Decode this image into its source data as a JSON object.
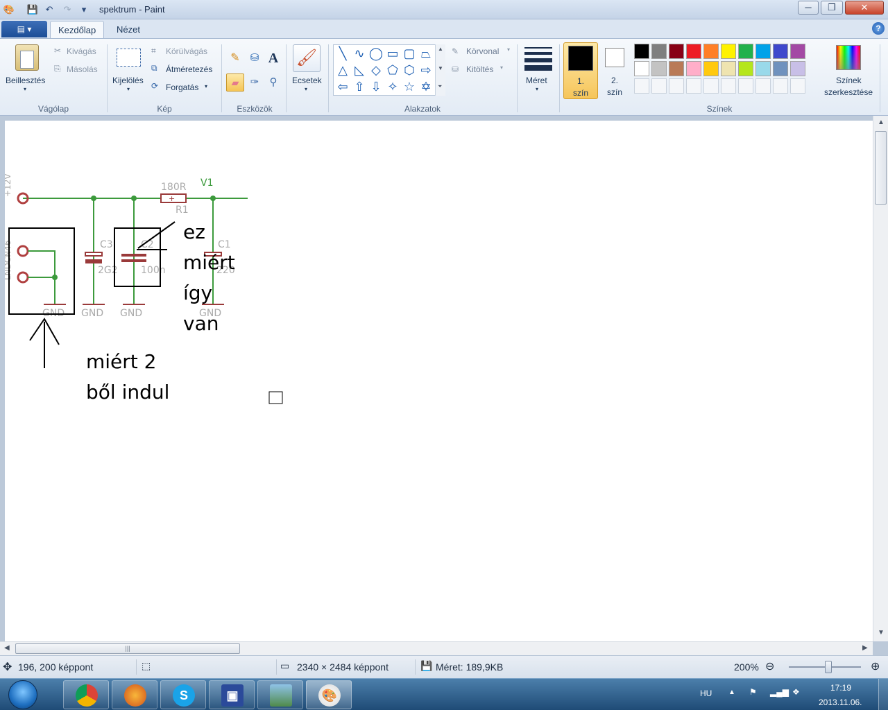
{
  "window": {
    "title": "spektrum - Paint",
    "minimize": "─",
    "maximize": "❐",
    "close": "✕"
  },
  "tabs": {
    "app_menu": "▤ ▾",
    "home": "Kezdőlap",
    "view": "Nézet"
  },
  "clipboard": {
    "paste": "Beillesztés",
    "cut": "Kivágás",
    "copy": "Másolás",
    "label": "Vágólap"
  },
  "image": {
    "select": "Kijelölés",
    "crop": "Körülvágás",
    "resize": "Átméretezés",
    "rotate": "Forgatás",
    "label": "Kép"
  },
  "tools": {
    "label": "Eszközök"
  },
  "brushes": {
    "label": "Ecsetek"
  },
  "shapes": {
    "label": "Alakzatok",
    "outline": "Körvonal",
    "fill": "Kitöltés"
  },
  "size": {
    "label": "Méret"
  },
  "colors": {
    "color1_line1": "1.",
    "color1_line2": "szín",
    "color2_line1": "2.",
    "color2_line2": "szín",
    "edit_line1": "Színek",
    "edit_line2": "szerkesztése",
    "label": "Színek",
    "color1_value": "#000000",
    "color2_value": "#ffffff",
    "palette_row1": [
      "#000000",
      "#7f7f7f",
      "#880015",
      "#ed1c24",
      "#ff7f27",
      "#fff200",
      "#22b14c",
      "#00a2e8",
      "#3f48cc",
      "#a349a4"
    ],
    "palette_row2": [
      "#ffffff",
      "#c3c3c3",
      "#b97a57",
      "#ffaec9",
      "#ffc90e",
      "#efe4b0",
      "#b5e61d",
      "#99d9ea",
      "#7092be",
      "#c8bfe7"
    ]
  },
  "canvas": {
    "circuit_labels": {
      "supply": "+12V",
      "resistor_value": "180R",
      "resistor_name": "R1",
      "v1": "V1",
      "c3": "C3",
      "c3_value": "2G2",
      "c2": "C2",
      "c2_value": "100n",
      "c1": "C1",
      "c1_value": "220",
      "connector": "LNDCN46",
      "gnd": "GND"
    },
    "annotation1": [
      "ez",
      "miért",
      "így",
      "van"
    ],
    "annotation2": [
      "miért 2",
      "ből indul"
    ]
  },
  "status": {
    "cursor_pos": "196, 200 képpont",
    "dimensions": "2340 × 2484 képpont",
    "file_size": "Méret: 189,9KB",
    "zoom": "200%"
  },
  "taskbar": {
    "language": "HU",
    "time": "17:19",
    "date": "2013.11.06."
  }
}
